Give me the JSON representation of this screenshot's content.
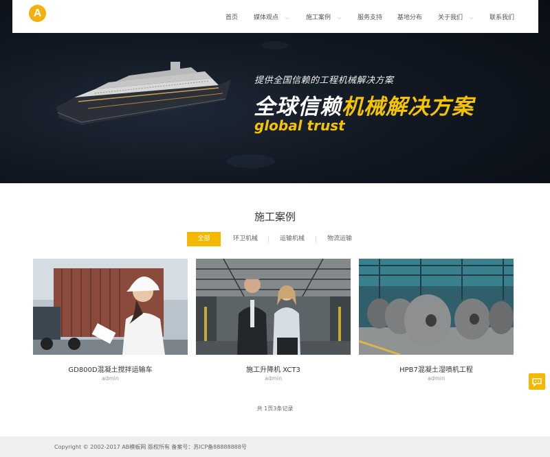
{
  "nav": {
    "items": [
      {
        "label": "首页",
        "dropdown": false
      },
      {
        "label": "媒体观点",
        "dropdown": true
      },
      {
        "label": "施工案例",
        "dropdown": true
      },
      {
        "label": "服务支持",
        "dropdown": false
      },
      {
        "label": "基地分布",
        "dropdown": false
      },
      {
        "label": "关于我们",
        "dropdown": true
      },
      {
        "label": "联系我们",
        "dropdown": false
      }
    ],
    "logo_letter": "A"
  },
  "hero": {
    "tagline": "提供全国信赖的工程机械解决方案",
    "headline_white": "全球信赖",
    "headline_yellow": "机械解决方案",
    "english": "global trust"
  },
  "section": {
    "title": "施工案例",
    "filters": [
      {
        "label": "全部",
        "active": true
      },
      {
        "label": "环卫机械",
        "active": false
      },
      {
        "label": "运输机械",
        "active": false
      },
      {
        "label": "物流运输",
        "active": false
      }
    ]
  },
  "cards": [
    {
      "title": "GD800D混凝土搅拌运输车",
      "author": "admin",
      "image": "worker-with-container-image"
    },
    {
      "title": "施工升降机 XCT3",
      "author": "admin",
      "image": "business-people-warehouse-image"
    },
    {
      "title": "HPB7混凝土湿喷机工程",
      "author": "admin",
      "image": "steel-coils-image"
    }
  ],
  "pager": "共 1页3条记录",
  "footer": "Copyright © 2002-2017 AB模板网 版权所有  备案号：苏ICP备88888888号",
  "colors": {
    "accent": "#f5b800",
    "hero_bg": "#111822",
    "footer_bg": "#efefef"
  },
  "icons": {
    "chat": "chat-icon"
  }
}
